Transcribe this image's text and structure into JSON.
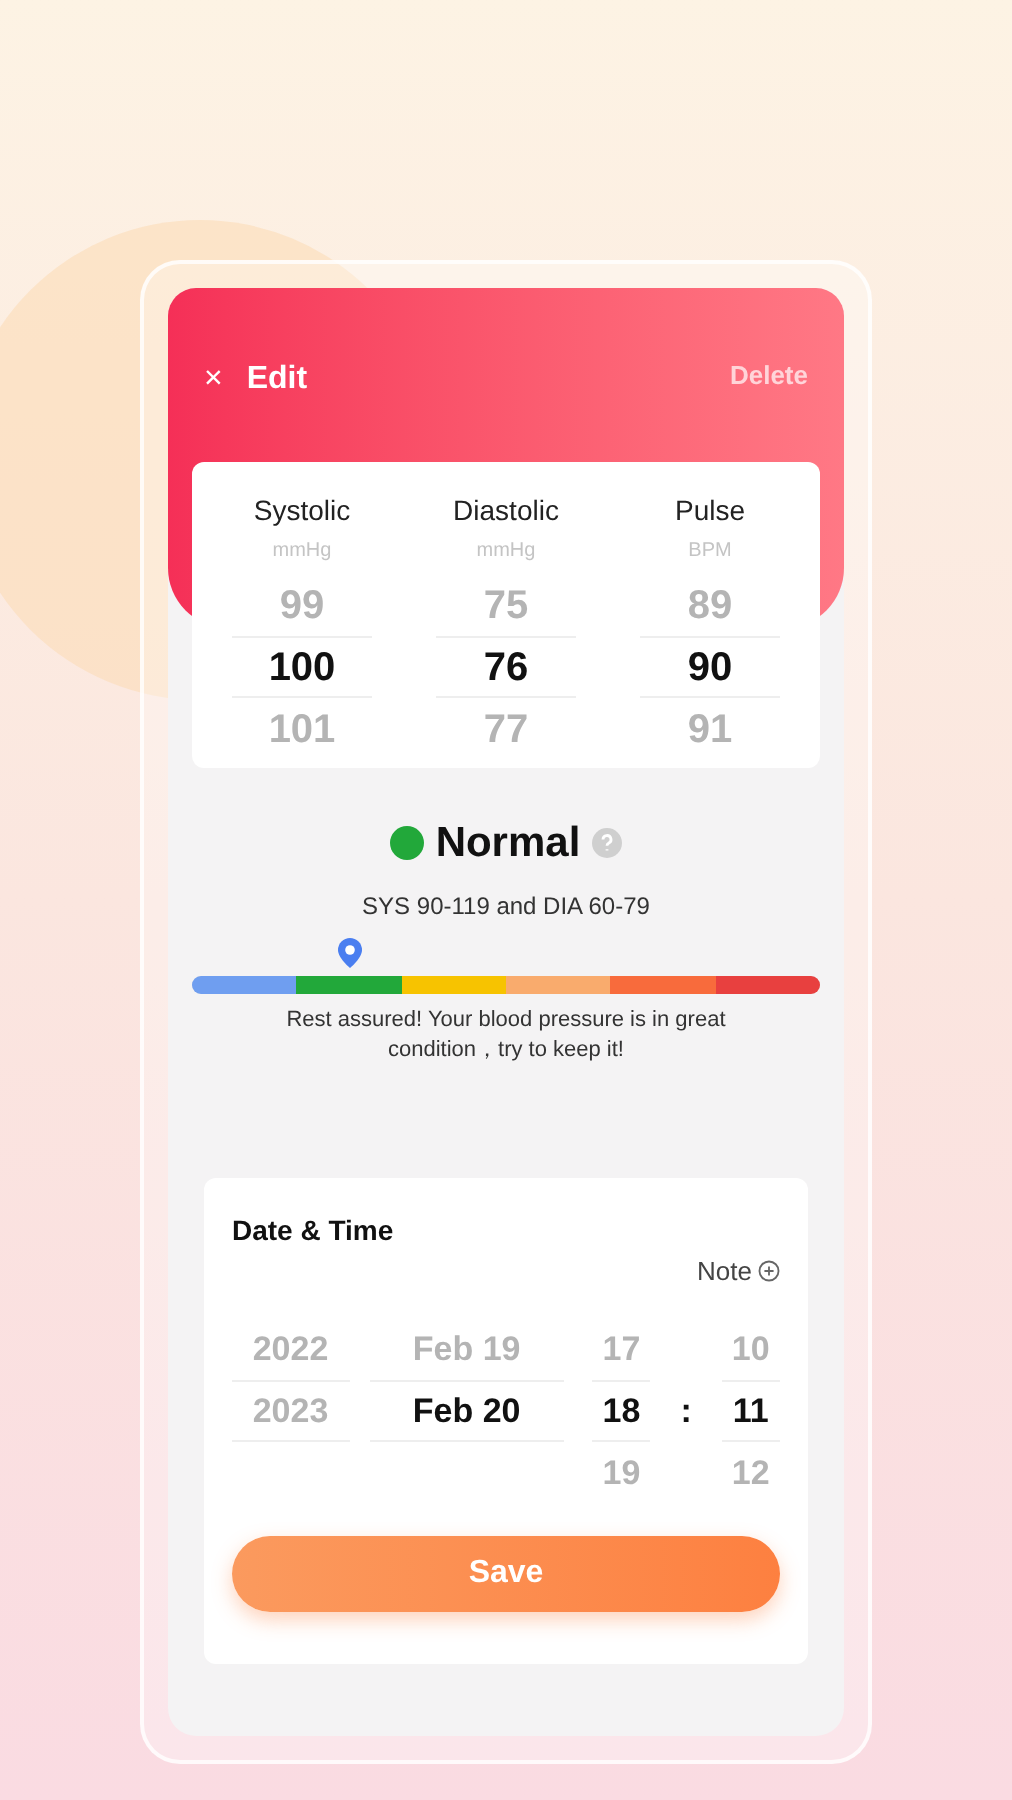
{
  "header": {
    "close": "×",
    "title": "Edit",
    "action": "Delete"
  },
  "readings": [
    {
      "label": "Systolic",
      "unit": "mmHg",
      "items": [
        {
          "value": "99",
          "selected": false
        },
        {
          "value": "100",
          "selected": true
        },
        {
          "value": "101",
          "selected": false
        }
      ]
    },
    {
      "label": "Diastolic",
      "unit": "mmHg",
      "items": [
        {
          "value": "75",
          "selected": false
        },
        {
          "value": "76",
          "selected": true
        },
        {
          "value": "77",
          "selected": false
        }
      ]
    },
    {
      "label": "Pulse",
      "unit": "BPM",
      "items": [
        {
          "value": "89",
          "selected": false
        },
        {
          "value": "90",
          "selected": true
        },
        {
          "value": "91",
          "selected": false
        }
      ]
    }
  ],
  "status": {
    "label": "Normal",
    "color": "#22a83a",
    "range": "SYS 90-119 and DIA 60-79",
    "level": 0.25,
    "message": "Rest assured!  Your blood pressure is in great condition，try to keep it!",
    "scale": [
      {
        "color": "#6f9ef0"
      },
      {
        "color": "#22a83a"
      },
      {
        "color": "#f7c300"
      },
      {
        "color": "#f9ab6d"
      },
      {
        "color": "#f86b3c"
      },
      {
        "color": "#e8403f"
      }
    ]
  },
  "date_time": {
    "title": "Date & Time",
    "note": "Note",
    "separator": ":",
    "columns": [
      {
        "items": [
          {
            "value": "2022",
            "selected": false
          },
          {
            "value": "2023",
            "selected": false
          }
        ]
      },
      {
        "items": [
          {
            "value": "Feb 19",
            "selected": false
          },
          {
            "value": "Feb 20",
            "selected": true
          }
        ]
      },
      {
        "items": [
          {
            "value": "17",
            "selected": false
          },
          {
            "value": "18",
            "selected": true
          },
          {
            "value": "19",
            "selected": false
          }
        ]
      },
      {
        "items": [
          {
            "value": "10",
            "selected": false
          },
          {
            "value": "11",
            "selected": true
          },
          {
            "value": "12",
            "selected": false
          }
        ]
      }
    ]
  },
  "save": "Save"
}
